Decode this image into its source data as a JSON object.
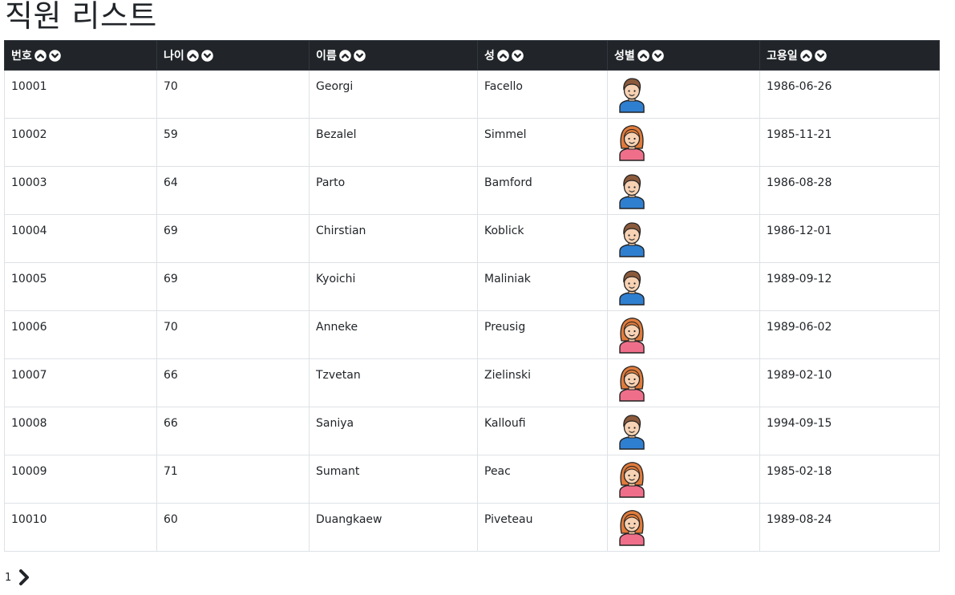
{
  "page": {
    "title": "직원 리스트"
  },
  "table": {
    "columns": [
      {
        "key": "emp_no",
        "label": "번호"
      },
      {
        "key": "age",
        "label": "나이"
      },
      {
        "key": "first_name",
        "label": "이름"
      },
      {
        "key": "last_name",
        "label": "성"
      },
      {
        "key": "gender",
        "label": "성별"
      },
      {
        "key": "hire_date",
        "label": "고용일"
      }
    ],
    "rows": [
      {
        "emp_no": "10001",
        "age": "70",
        "first_name": "Georgi",
        "last_name": "Facello",
        "gender": "M",
        "hire_date": "1986-06-26"
      },
      {
        "emp_no": "10002",
        "age": "59",
        "first_name": "Bezalel",
        "last_name": "Simmel",
        "gender": "F",
        "hire_date": "1985-11-21"
      },
      {
        "emp_no": "10003",
        "age": "64",
        "first_name": "Parto",
        "last_name": "Bamford",
        "gender": "M",
        "hire_date": "1986-08-28"
      },
      {
        "emp_no": "10004",
        "age": "69",
        "first_name": "Chirstian",
        "last_name": "Koblick",
        "gender": "M",
        "hire_date": "1986-12-01"
      },
      {
        "emp_no": "10005",
        "age": "69",
        "first_name": "Kyoichi",
        "last_name": "Maliniak",
        "gender": "M",
        "hire_date": "1989-09-12"
      },
      {
        "emp_no": "10006",
        "age": "70",
        "first_name": "Anneke",
        "last_name": "Preusig",
        "gender": "F",
        "hire_date": "1989-06-02"
      },
      {
        "emp_no": "10007",
        "age": "66",
        "first_name": "Tzvetan",
        "last_name": "Zielinski",
        "gender": "F",
        "hire_date": "1989-02-10"
      },
      {
        "emp_no": "10008",
        "age": "66",
        "first_name": "Saniya",
        "last_name": "Kalloufi",
        "gender": "M",
        "hire_date": "1994-09-15"
      },
      {
        "emp_no": "10009",
        "age": "71",
        "first_name": "Sumant",
        "last_name": "Peac",
        "gender": "F",
        "hire_date": "1985-02-18"
      },
      {
        "emp_no": "10010",
        "age": "60",
        "first_name": "Duangkaew",
        "last_name": "Piveteau",
        "gender": "F",
        "hire_date": "1989-08-24"
      }
    ]
  },
  "icons": {
    "sort_asc": "chevron-up-circle-icon",
    "sort_desc": "chevron-down-circle-icon",
    "male": "male-avatar-icon",
    "female": "female-avatar-icon",
    "next": "chevron-right-icon"
  },
  "pagination": {
    "current_page": "1"
  }
}
